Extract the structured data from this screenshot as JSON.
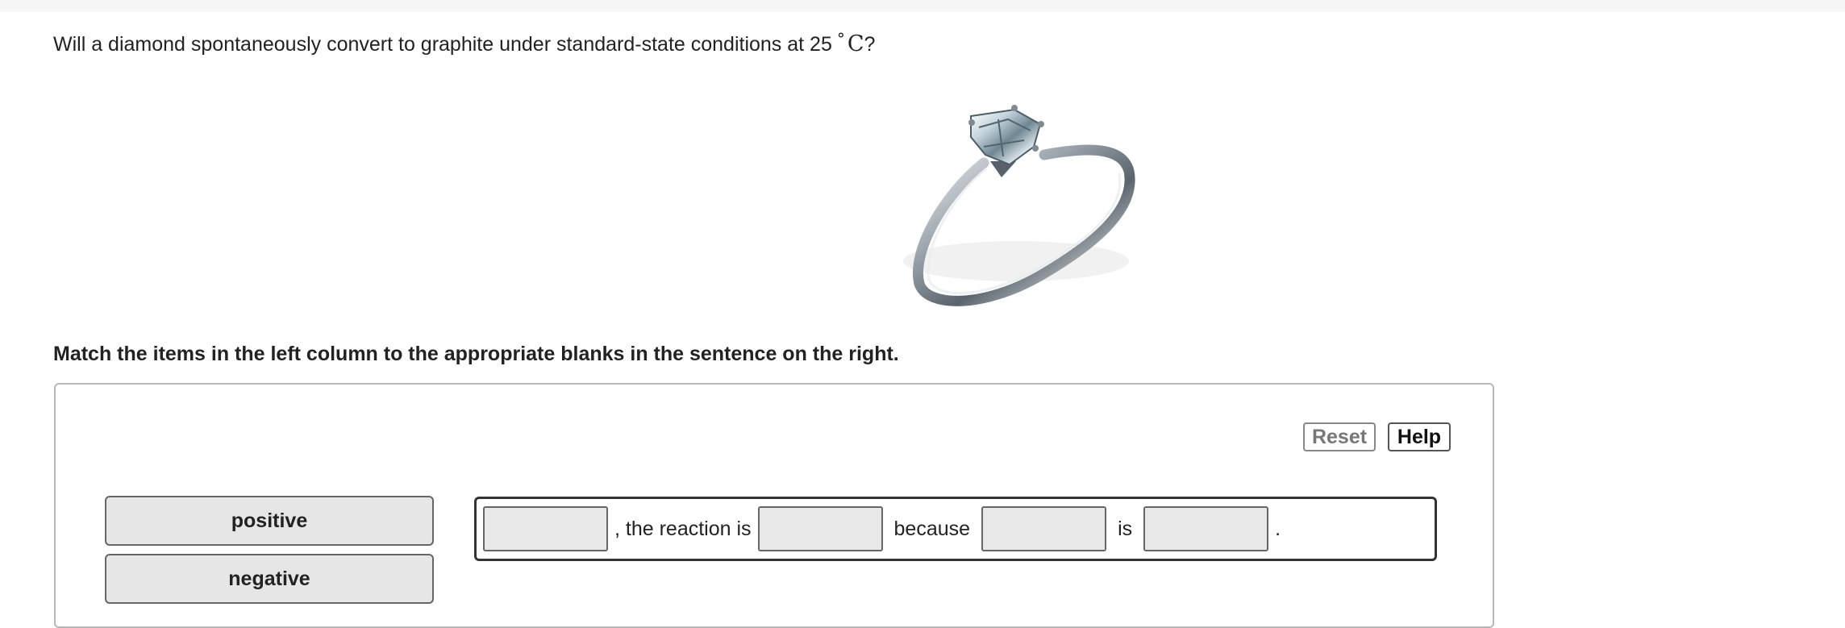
{
  "question": {
    "text": "Will a diamond spontaneously convert to graphite under standard-state conditions at 25",
    "degree": "°",
    "unit": "C",
    "end": "?"
  },
  "image": {
    "icon": "diamond-ring"
  },
  "instructions": "Match the items in the left column to the appropriate blanks in the sentence on the right.",
  "toolbar": {
    "reset_label": "Reset",
    "help_label": "Help"
  },
  "items": [
    "positive",
    "negative"
  ],
  "sentence": {
    "seg1": ", the reaction is",
    "seg2": "because",
    "seg3": "is",
    "seg4": "."
  }
}
